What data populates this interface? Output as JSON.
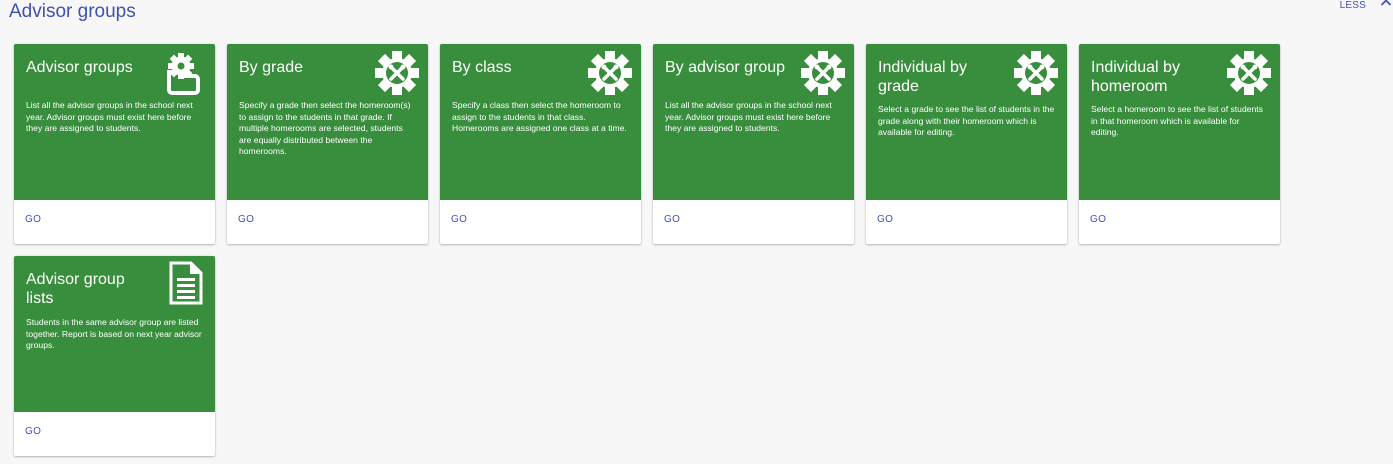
{
  "header": {
    "title": "Advisor groups",
    "toggle_label": "LESS",
    "toggle_icon": "chevron-up-icon"
  },
  "colors": {
    "accent": "#3f51b5",
    "card_green": "#388e3c",
    "background": "#f7f7f8"
  },
  "cards": [
    {
      "title": "Advisor groups",
      "description": "List all the advisor groups in the school next year. Advisor groups must exist here before they are assigned to students.",
      "icon": "gear-folder-icon",
      "action": "GO"
    },
    {
      "title": "By grade",
      "description": "Specify a grade then select the homeroom(s) to assign to the students in that grade. If multiple homerooms are selected, students are equally distributed between the homerooms.",
      "icon": "gear-tools-icon",
      "action": "GO"
    },
    {
      "title": "By class",
      "description": "Specify a class then select the homeroom to assign to the students in that class. Homerooms are assigned one class at a time.",
      "icon": "gear-tools-icon",
      "action": "GO"
    },
    {
      "title": "By advisor group",
      "description": "List all the advisor groups in the school next year. Advisor groups must exist here before they are assigned to students.",
      "icon": "gear-tools-icon",
      "action": "GO"
    },
    {
      "title": "Individual by grade",
      "description": "Select a grade to see the list of students in the grade along with their homeroom which is available for editing.",
      "icon": "gear-tools-icon",
      "action": "GO"
    },
    {
      "title": "Individual by homeroom",
      "description": "Select a homeroom to see the list of students in that homeroom which is available for editing.",
      "icon": "gear-tools-icon",
      "action": "GO"
    },
    {
      "title": "Advisor group lists",
      "description": "Students in the same advisor group are listed together. Report is based on next year advisor groups.",
      "icon": "document-list-icon",
      "action": "GO"
    }
  ]
}
